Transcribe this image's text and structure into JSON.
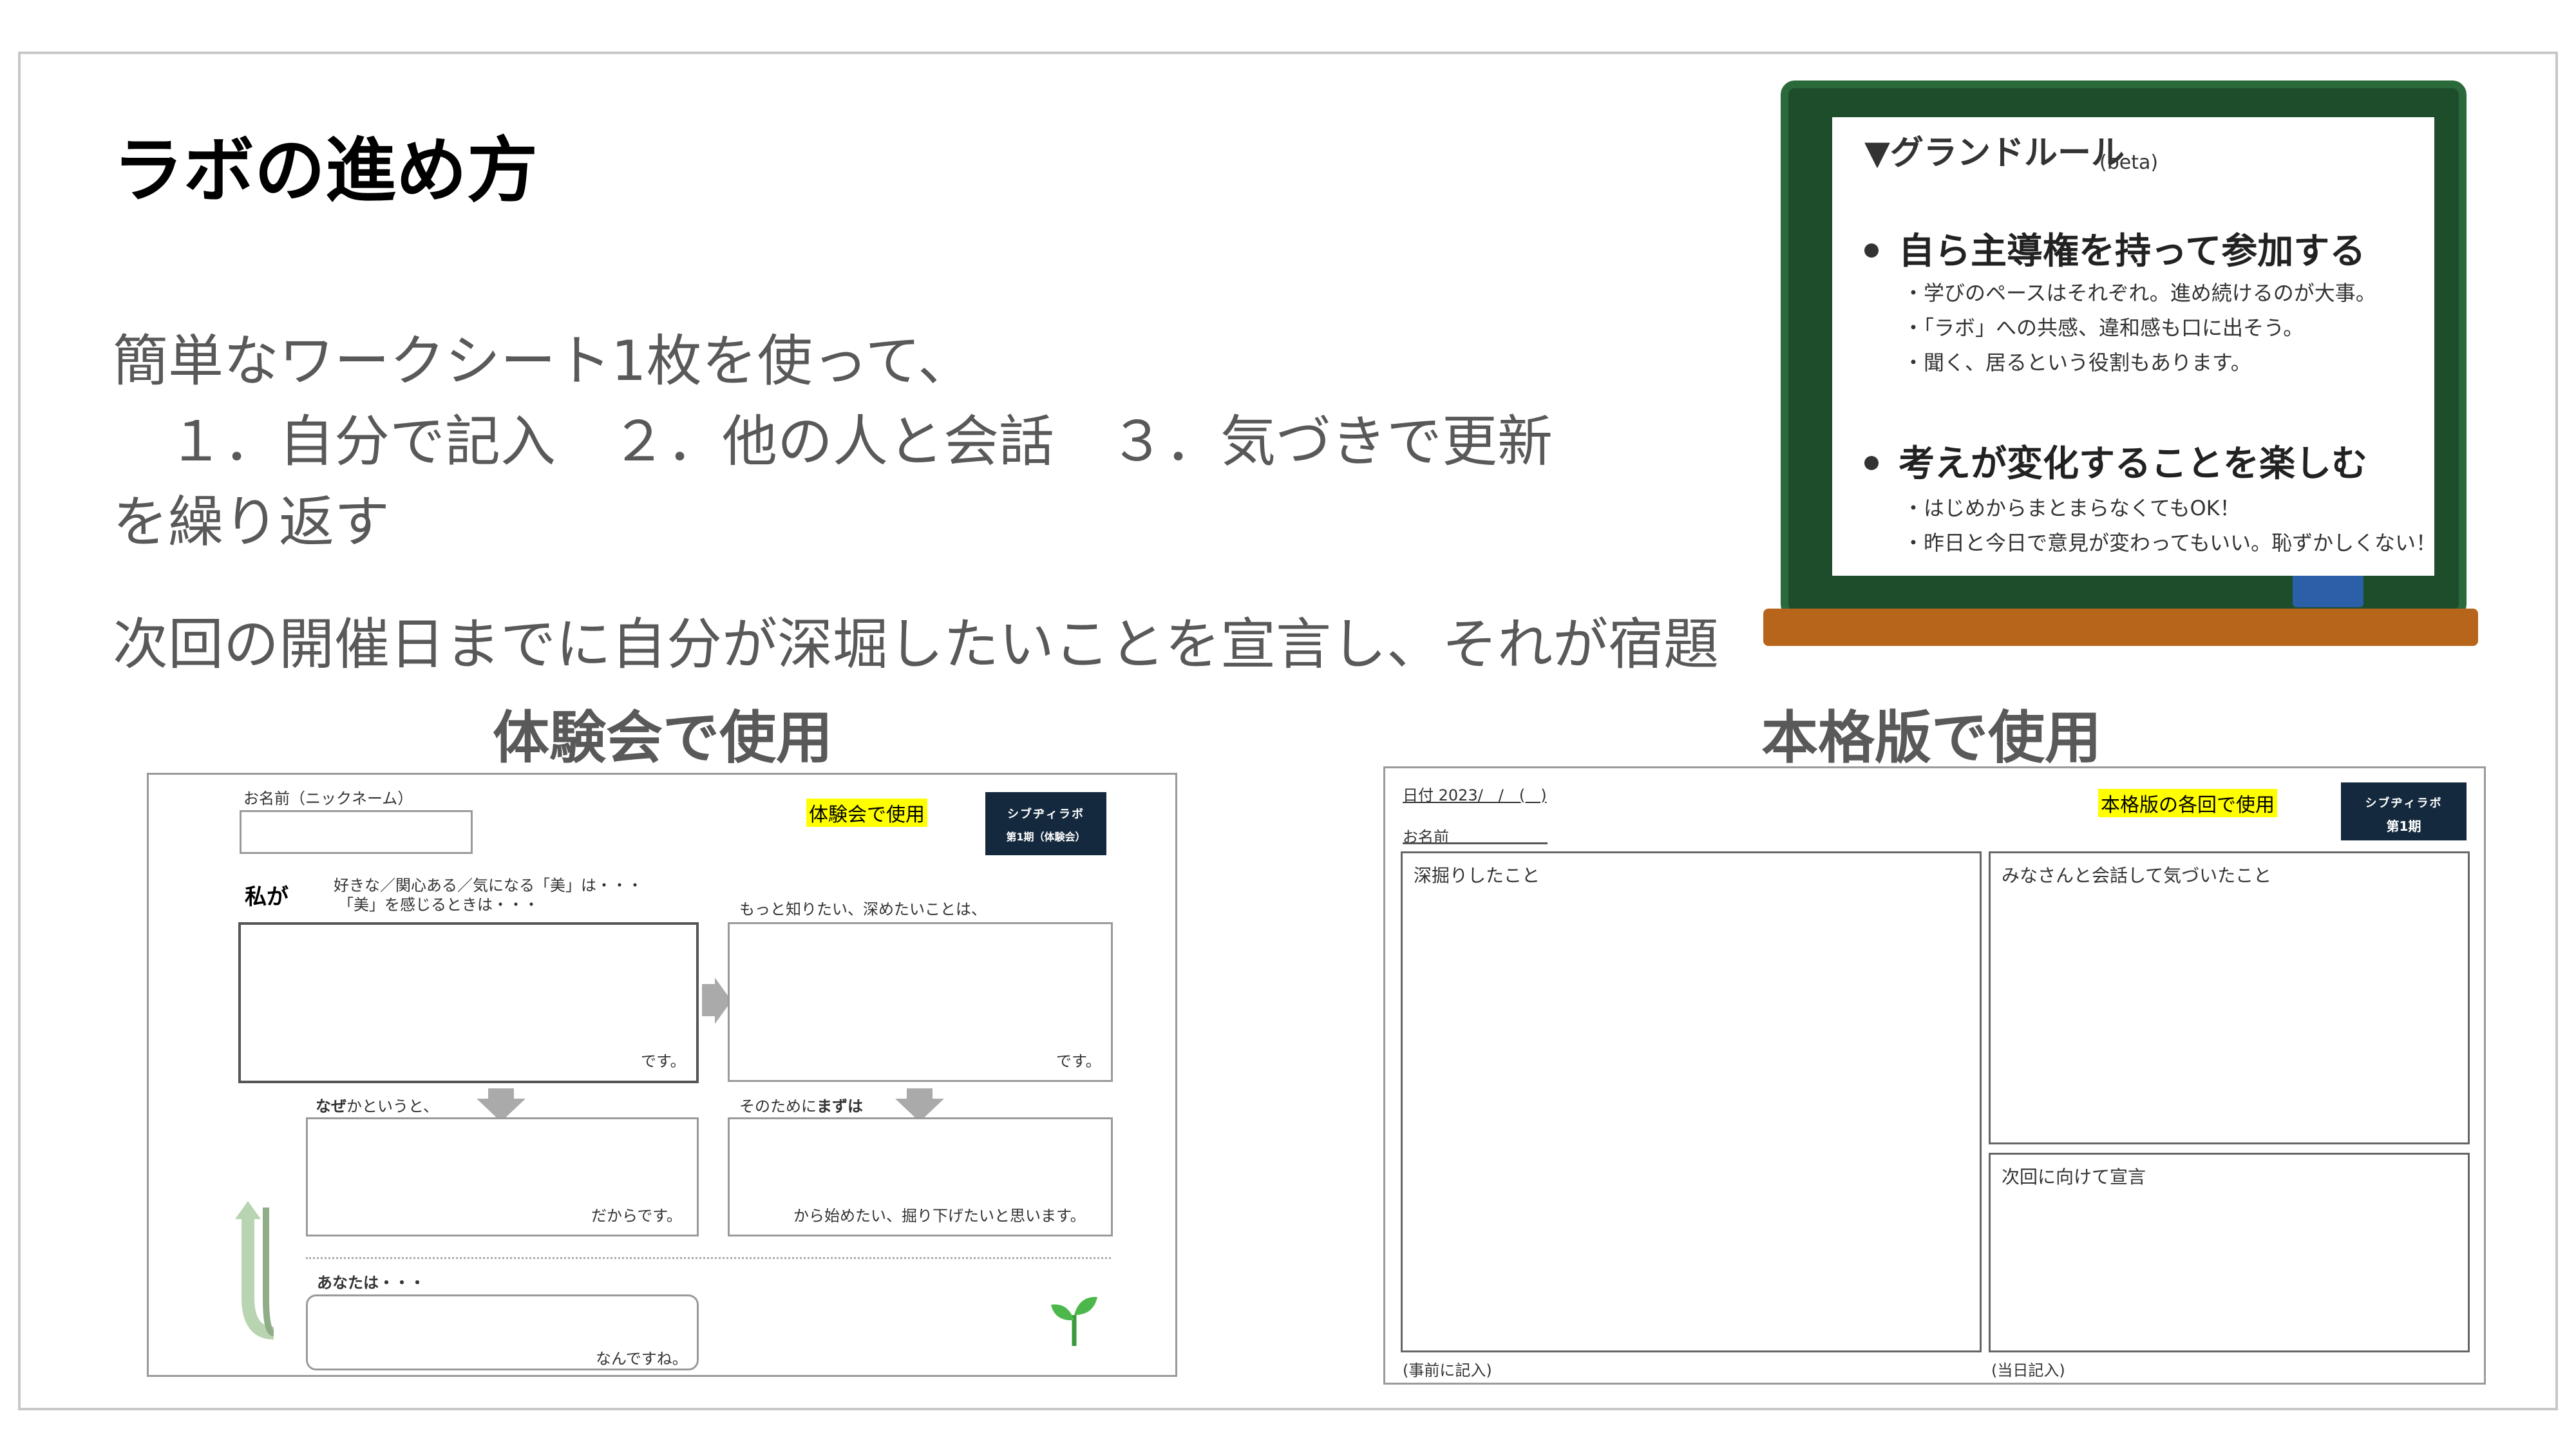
{
  "slide": {
    "title": "ラボの進め方",
    "body_line1": "簡単なワークシート1枚を使って、",
    "body_line2": "　１．自分で記入　２．他の人と会話　３．気づきで更新",
    "body_line3": "を繰り返す",
    "body_line4": "次回の開催日までに自分が深堀したいことを宣言し、それが宿題",
    "caption_trial": "体験会で使用",
    "caption_full": "本格版で使用"
  },
  "board": {
    "title": "▼グランドルール",
    "beta": "(beta)",
    "rule1_head": "自ら主導権を持って参加する",
    "rule1_items": [
      "・学びのペースはそれぞれ。進め続けるのが大事。",
      "・「ラボ」への共感、違和感も口に出そう。",
      "・聞く、居るという役割もあります。"
    ],
    "rule2_head": "考えが変化することを楽しむ",
    "rule2_items": [
      "・はじめからまとまらなくてもOK！",
      "・昨日と今日で意見が変わってもいい。恥ずかしくない！"
    ]
  },
  "trial_sheet": {
    "name_label": "お名前（ニックネーム）",
    "highlight": "体験会で使用",
    "logo_line1": "シブヂィラボ",
    "logo_line2": "第1期（体験会）",
    "watashi": "私が",
    "prompt1a": "好きな／関心ある／気になる「美」は・・・",
    "prompt1b": "「美」を感じるときは・・・",
    "prompt2": "もっと知りたい、深めたいことは、",
    "desu1": "です。",
    "desu2": "です。",
    "naze_bold": "なぜ",
    "naze_rest": "かというと、",
    "sonotame_pre": "そのために",
    "sonotame_bold": "まずは",
    "dakara": "だからです。",
    "kara": "から始めたい、掘り下げたいと思います。",
    "anata": "あなたは・・・",
    "nandesu": "なんですね。",
    "sprout_icon": "sprout-icon"
  },
  "full_sheet": {
    "date_label": "日付 2023/　/　(　)",
    "name_label": "お名前",
    "highlight": "本格版の各回で使用",
    "logo_line1": "シブヂィラボ",
    "logo_line2": "第1期",
    "box1": "深掘りしたこと",
    "box2": "みなさんと会話して気づいたこと",
    "box3": "次回に向けて宣言",
    "note_left": "(事前に記入)",
    "note_right": "(当日記入)"
  }
}
